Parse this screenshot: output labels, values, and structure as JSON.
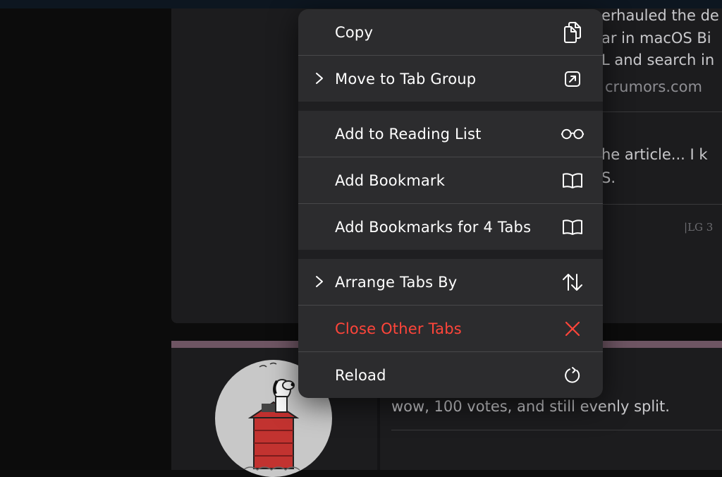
{
  "background": {
    "article_lines": [
      "erhauled the de",
      "ar in macOS Bi",
      "L and search in",
      "crumors.com"
    ],
    "comment_lines": [
      "he article... I k",
      "S."
    ],
    "signature_fragment": "LG 3",
    "bottom_comment": "wow, 100 votes, and still evenly split."
  },
  "menu": {
    "items": [
      {
        "label": "Copy",
        "icon": "copy-icon"
      },
      {
        "label": "Move to Tab Group",
        "icon": "move-to-tab-group-icon",
        "submenu": true
      },
      {
        "label": "Add to Reading List",
        "icon": "glasses-icon"
      },
      {
        "label": "Add Bookmark",
        "icon": "book-icon"
      },
      {
        "label": "Add Bookmarks for 4 Tabs",
        "icon": "book-icon"
      },
      {
        "label": "Arrange Tabs By",
        "icon": "sort-arrows-icon",
        "submenu": true
      },
      {
        "label": "Close Other Tabs",
        "icon": "close-icon",
        "destructive": true
      },
      {
        "label": "Reload",
        "icon": "reload-icon"
      }
    ]
  },
  "colors": {
    "menu_bg": "#2c2c2e",
    "text": "#ffffff",
    "destructive": "#ff453a",
    "page_bg": "#1c1c1e"
  }
}
